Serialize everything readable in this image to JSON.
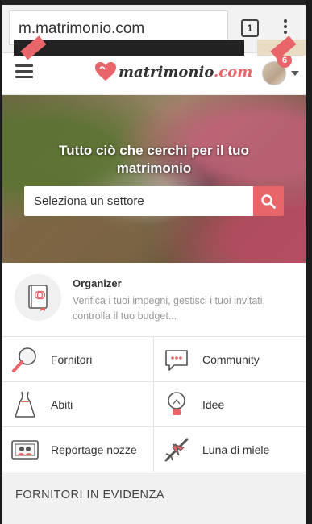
{
  "browser": {
    "url": "m.matrimonio.com",
    "tab_count": "1"
  },
  "header": {
    "logo_name": "matrimonio",
    "logo_tld": ".com",
    "notification_count": "6"
  },
  "hero": {
    "title": "Tutto ciò che cerchi per il tuo matrimonio",
    "search_placeholder": "Seleziona un settore"
  },
  "organizer": {
    "title": "Organizer",
    "description": "Verifica i tuoi impegni, gestisci i tuoi invitati, controlla il tuo budget..."
  },
  "categories": [
    {
      "label": "Fornitori",
      "icon": "magnifier-icon"
    },
    {
      "label": "Community",
      "icon": "speech-bubble-icon"
    },
    {
      "label": "Abiti",
      "icon": "dress-icon"
    },
    {
      "label": "Idee",
      "icon": "lightbulb-icon"
    },
    {
      "label": "Reportage nozze",
      "icon": "photo-album-icon"
    },
    {
      "label": "Luna di miele",
      "icon": "airplane-icon"
    }
  ],
  "featured": {
    "title": "FORNITORI IN EVIDENZA"
  },
  "colors": {
    "accent": "#e8656a"
  }
}
